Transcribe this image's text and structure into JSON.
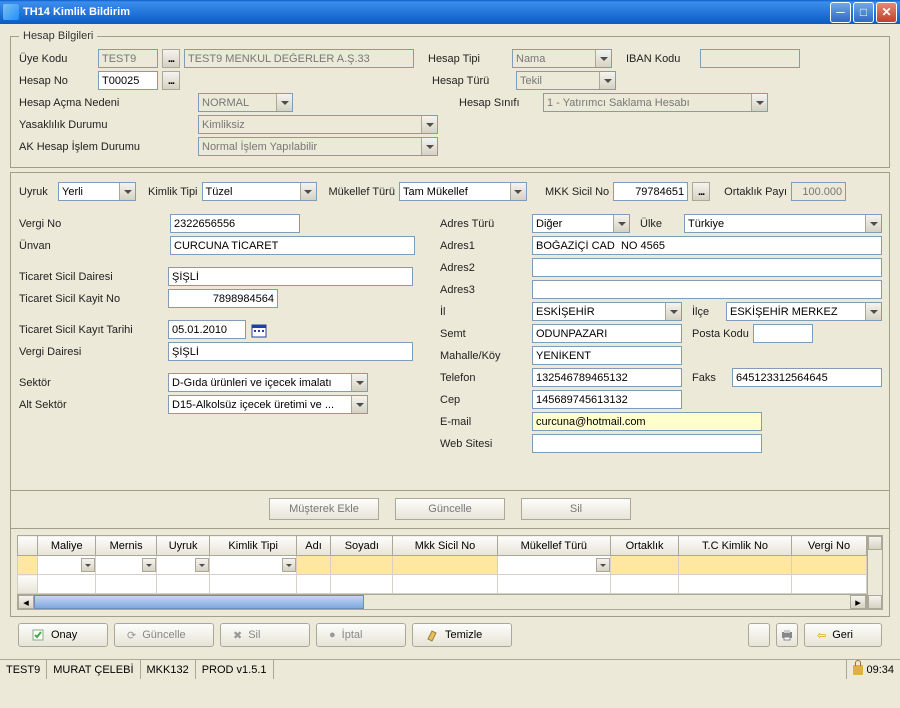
{
  "window": {
    "title": "TH14 Kimlik Bildirim"
  },
  "hesap": {
    "legend": "Hesap Bilgileri",
    "uye_kodu_label": "Üye Kodu",
    "uye_kodu": "TEST9",
    "uye_adi": "TEST9 MENKUL DEĞERLER A.Ş.33",
    "hesap_tipi_label": "Hesap Tipi",
    "hesap_tipi": "Nama",
    "iban_label": "IBAN Kodu",
    "iban": "",
    "hesap_no_label": "Hesap No",
    "hesap_no": "T00025",
    "hesap_turu_label": "Hesap Türü",
    "hesap_turu": "Tekil",
    "acma_nedeni_label": "Hesap Açma Nedeni",
    "acma_nedeni": "NORMAL",
    "sinif_label": "Hesap Sınıfı",
    "sinif": "1 - Yatırımcı Saklama Hesabı",
    "yasak_label": "Yasaklılık Durumu",
    "yasak": "Kimliksiz",
    "ak_label": "AK Hesap İşlem Durumu",
    "ak": "Normal İşlem Yapılabilir"
  },
  "kimlik": {
    "uyruk_label": "Uyruk",
    "uyruk": "Yerli",
    "tipi_label": "Kimlik Tipi",
    "tipi": "Tüzel",
    "mukellef_label": "Mükellef Türü",
    "mukellef": "Tam Mükellef",
    "sicil_label": "MKK Sicil No",
    "sicil": "79784651",
    "ortaklik_label": "Ortaklık Payı",
    "ortaklik": "100.000"
  },
  "left": {
    "vergino_label": "Vergi No",
    "vergino": "2322656556",
    "unvan_label": "Ünvan",
    "unvan": "CURCUNA TİCARET",
    "tsd_label": "Ticaret Sicil Dairesi",
    "tsd": "ŞİŞLİ",
    "tskno_label": "Ticaret Sicil Kayit No",
    "tskno": "7898984564",
    "tskt_label": "Ticaret Sicil Kayıt Tarihi",
    "tskt": "05.01.2010",
    "vdaire_label": "Vergi Dairesi",
    "vdaire": "ŞİŞLİ",
    "sektor_label": "Sektör",
    "sektor": "D-Gıda ürünleri ve içecek imalatı",
    "altsektor_label": "Alt Sektör",
    "altsektor": "D15-Alkolsüz içecek üretimi ve ..."
  },
  "right": {
    "adresturu_label": "Adres Türü",
    "adresturu": "Diğer",
    "ulke_label": "Ülke",
    "ulke": "Türkiye",
    "adres1_label": "Adres1",
    "adres1": "BOĞAZİÇİ CAD  NO 4565",
    "adres2_label": "Adres2",
    "adres2": "",
    "adres3_label": "Adres3",
    "adres3": "",
    "il_label": "İl",
    "il": "ESKİŞEHİR",
    "ilce_label": "İlçe",
    "ilce": "ESKİŞEHİR MERKEZ",
    "semt_label": "Semt",
    "semt": "ODUNPAZARI",
    "posta_label": "Posta Kodu",
    "posta": "",
    "mah_label": "Mahalle/Köy",
    "mah": "YENİKENT",
    "tel_label": "Telefon",
    "tel": "132546789465132",
    "faks_label": "Faks",
    "faks": "645123312564645",
    "cep_label": "Cep",
    "cep": "145689745613132",
    "email_label": "E-mail",
    "email": "curcuna@hotmail.com",
    "web_label": "Web Sitesi",
    "web": ""
  },
  "buttons": {
    "musterek": "Müşterek Ekle",
    "guncelle": "Güncelle",
    "sil": "Sil",
    "onay": "Onay",
    "iptal": "İptal",
    "temizle": "Temizle",
    "geri": "Geri"
  },
  "grid": {
    "cols": [
      "Maliye",
      "Mernis",
      "Uyruk",
      "Kimlik Tipi",
      "Adı",
      "Soyadı",
      "Mkk Sicil No",
      "Mükellef Türü",
      "Ortaklık",
      "T.C Kimlik No",
      "Vergi No"
    ]
  },
  "status": {
    "user": "TEST9",
    "name": "MURAT ÇELEBİ",
    "term": "MKK132",
    "ver": "PROD v1.5.1",
    "time": "09:34"
  }
}
